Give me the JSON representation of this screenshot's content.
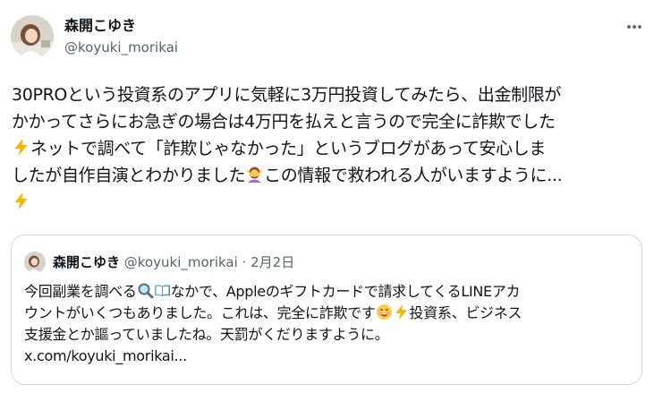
{
  "author": {
    "display_name": "森開こゆき",
    "handle": "@koyuki_morikai"
  },
  "tweet": {
    "line1": "30PROという投資系のアプリに気軽に3万円投資してみたら、出金制限が",
    "line2": "かかってさらにお急ぎの場合は4万円を払えと言うので完全に詐欺でした",
    "line3": "ネットで調べて「詐欺じゃなかった」というブログがあって安心しま",
    "line4a": "したが自作自演とわかりました",
    "line4b": "この情報で救われる人がいますように...",
    "icons": {
      "bolt": "high-voltage-icon",
      "facepalm": "person-gesturing-no-icon"
    }
  },
  "quote": {
    "display_name": "森開こゆき",
    "handle": "@koyuki_morikai",
    "separator": "·",
    "date": "2月2日",
    "line1a": "今回副業を調べる",
    "line1b": "なかで、Appleのギフトカードで請求してくるLINEアカ",
    "line2a": "ウントがいくつもありました。これは、完全に詐欺です",
    "line2b": "投資系、ビジネス",
    "line3": "支援金とか謳っていましたね。天罰がくだりますように。",
    "link": "x.com/koyuki_morikai..."
  },
  "colors": {
    "text": "#0f1419",
    "secondary": "#536471",
    "border": "#cfd9de",
    "bolt": "#f4b400"
  }
}
